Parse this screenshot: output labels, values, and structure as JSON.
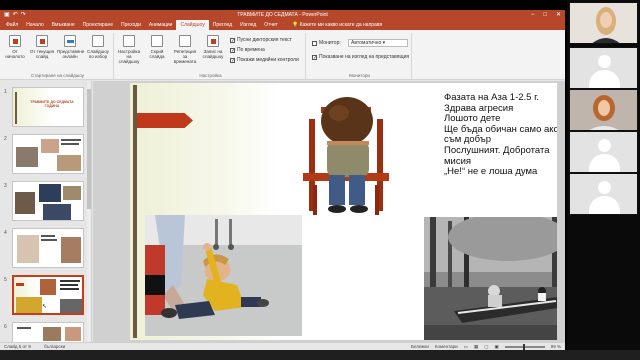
{
  "window": {
    "title": "ТРАВМИТЕ ДО СЕДМАТА - PowerPoint",
    "accent": "#b7472a",
    "controls": [
      "−",
      "□",
      "✕"
    ]
  },
  "tabs": {
    "items": [
      "Файл",
      "Начало",
      "Вмъкване",
      "Проектиране",
      "Преходи",
      "Анимации",
      "Слайдшоу",
      "Преглед",
      "Изглед",
      "Отчет"
    ],
    "active": "Слайдшоу",
    "tell_me": "Кажете ми какво искате да направя"
  },
  "ribbon": {
    "from_start": "От началото",
    "from_current": "От текущия слайд",
    "present_online": "Представяне онлайн",
    "custom_show": "Слайдшоу по избор",
    "group_start": "Стартиране на слайдшоу",
    "setup_show": "Настройка на слайдшоу",
    "hide_slide": "Скрий слайда",
    "rehearse": "Репетиция за времената",
    "record": "Запис на слайдшоу",
    "group_setup": "Настройка",
    "play_narrations": "Пусни дикторския текст",
    "use_timings": "По времена",
    "show_media": "Покажи медийни контроли",
    "monitor_label": "Монитор:",
    "monitor_value": "Автоматично",
    "presenter_view": "Показване на изглед на представящия",
    "group_monitors": "Монитори"
  },
  "thumbnails": {
    "items": [
      {
        "num": "1",
        "title": "ТРАВМИТЕ ДО СЕДМАТА ГОДИНА"
      },
      {
        "num": "2",
        "title": ""
      },
      {
        "num": "3",
        "title": ""
      },
      {
        "num": "4",
        "title": ""
      },
      {
        "num": "5",
        "title": ""
      },
      {
        "num": "6",
        "title": ""
      }
    ],
    "selected": "5"
  },
  "slide": {
    "lines": [
      "Фазата на Аза 1-2.5 г.",
      "Здрава агресия",
      "Лошото дете",
      "Ще бъда обичан само ако",
      "съм добър",
      "Послушният. Добротата",
      "мисия",
      "„Не!“ не е лоша дума"
    ]
  },
  "status": {
    "slide_info": "Слайд 5 от 9",
    "language": "български",
    "notes": "Бележки",
    "comments": "Коментари",
    "zoom": "99 %"
  },
  "participants": {
    "count": 6
  }
}
